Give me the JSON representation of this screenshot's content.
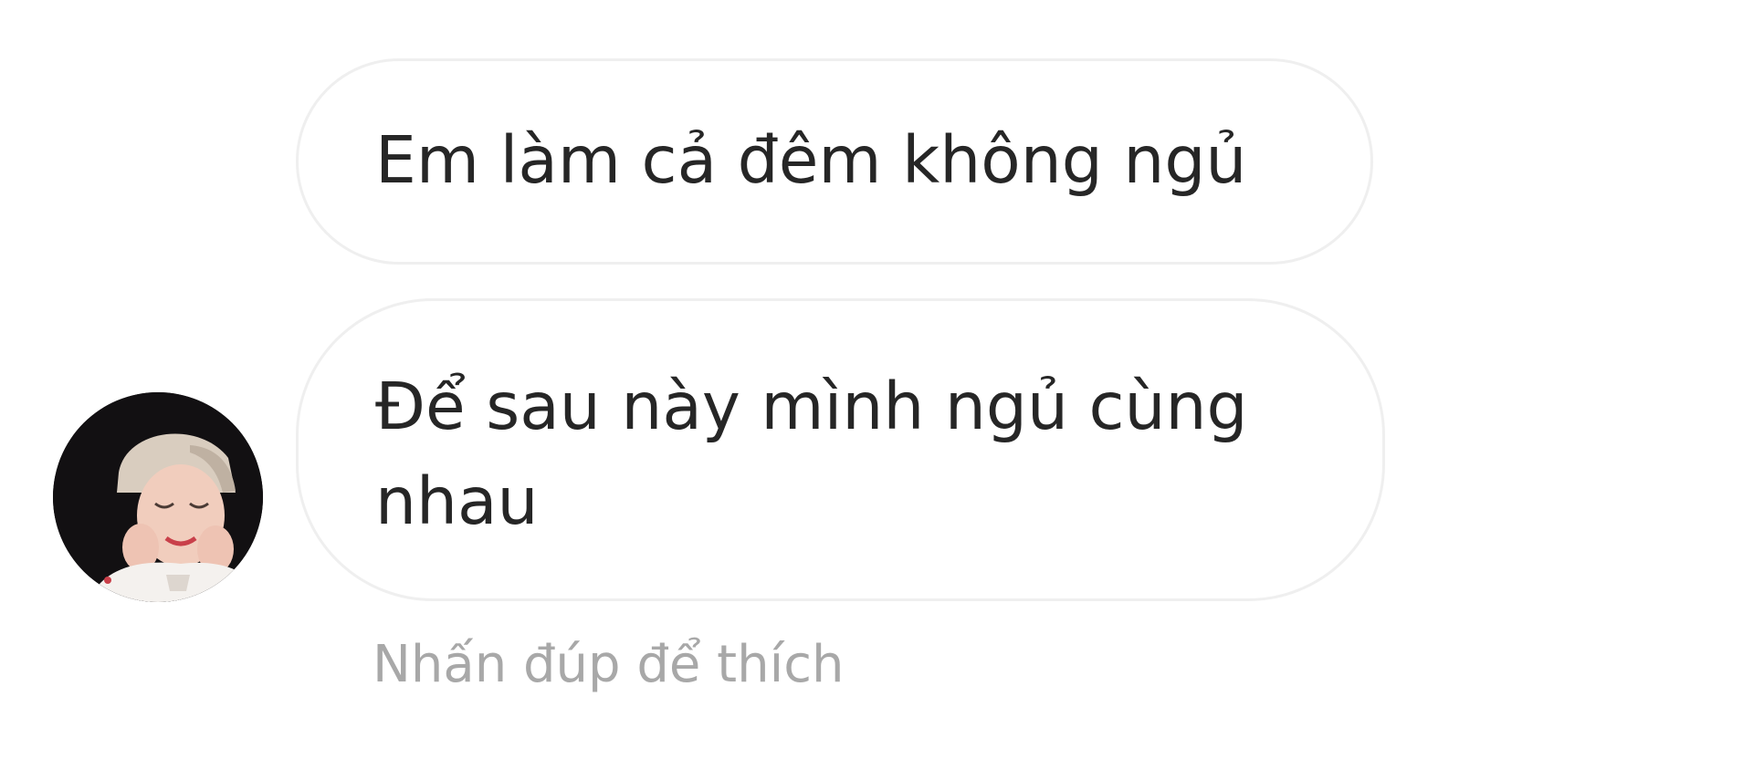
{
  "thread": {
    "messages": [
      {
        "text": "Em làm cả đêm không ngủ"
      },
      {
        "text": "Để sau này mình ngủ cùng nhau"
      }
    ],
    "hint": "Nhấn đúp để thích"
  },
  "avatar": {
    "icon": "user-avatar-photo"
  },
  "colors": {
    "bubble_border": "#efefef",
    "text": "#262626",
    "hint": "#a8a8a8",
    "background": "#ffffff"
  }
}
